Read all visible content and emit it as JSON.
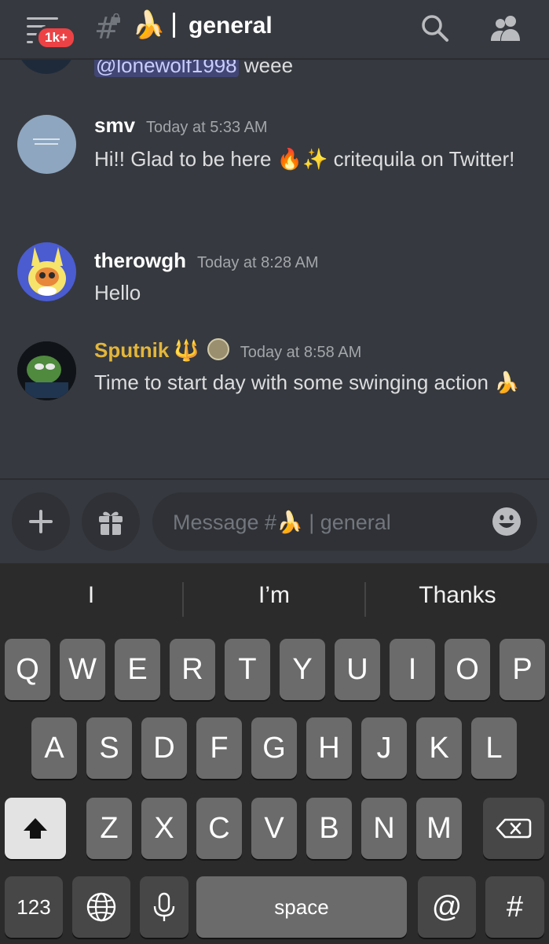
{
  "header": {
    "badge": "1k+",
    "channel_hash": "#",
    "channel_emoji": "🍌",
    "channel_name": "general"
  },
  "partial_message": {
    "mention": "@lonewolf1998",
    "text": "weee"
  },
  "messages": [
    {
      "username": "smv",
      "timestamp": "Today at 5:33 AM",
      "text": "Hi!! Glad to be here 🔥✨ critequila on Twitter!"
    },
    {
      "username": "therowgh",
      "timestamp": "Today at 8:28 AM",
      "text": "Hello"
    },
    {
      "username": "Sputnik",
      "username_badge": "🔱",
      "timestamp": "Today at 8:58 AM",
      "text": "Time to start day with some swinging action 🍌"
    }
  ],
  "composer": {
    "placeholder": "Message #🍌 | general"
  },
  "keyboard": {
    "suggestions": [
      "I",
      "I’m",
      "Thanks"
    ],
    "row1": [
      "Q",
      "W",
      "E",
      "R",
      "T",
      "Y",
      "U",
      "I",
      "O",
      "P"
    ],
    "row2": [
      "A",
      "S",
      "D",
      "F",
      "G",
      "H",
      "J",
      "K",
      "L"
    ],
    "row3": [
      "Z",
      "X",
      "C",
      "V",
      "B",
      "N",
      "M"
    ],
    "numbers_key": "123",
    "space_key": "space",
    "at_key": "@",
    "hash_key": "#"
  },
  "colors": {
    "background": "#36393f",
    "badge": "#ed4245",
    "username_highlight": "#e3b63b",
    "mention_bg": "#414675"
  },
  "icons": [
    "hamburger-menu-icon",
    "locked-channel-icon",
    "search-icon",
    "members-icon",
    "plus-icon",
    "gift-icon",
    "emoji-icon",
    "shift-icon",
    "backspace-icon",
    "globe-icon",
    "microphone-icon"
  ]
}
